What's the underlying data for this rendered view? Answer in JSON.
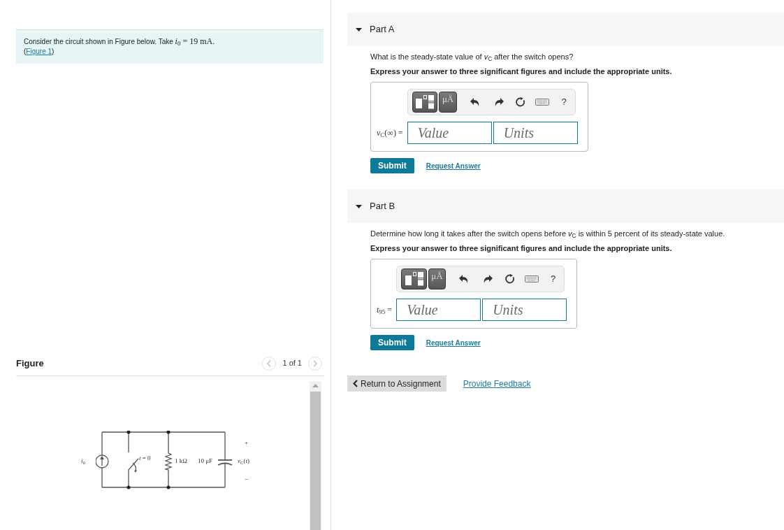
{
  "problem": {
    "text": "Consider the circuit shown in Figure below. Take ",
    "math": "*i*$_{0}$ = 19 mA.",
    "figure_link": {
      "open": "(",
      "label": "Figure 1",
      "close": ")"
    }
  },
  "figure": {
    "title": "Figure",
    "pager": {
      "prev": {
        "disabled": true
      },
      "position": "1 of 1",
      "next": {
        "disabled": true
      }
    },
    "diagram": {
      "source_label": "*i*$_{0}$",
      "switch_label": "*t* = 0",
      "resistor_label": "1 kΩ",
      "capacitor_label": "10 μF",
      "plus_sign": "+",
      "voltage_label": "*v*$_{C}$(*t*)",
      "minus_sign": "−"
    }
  },
  "parts": [
    {
      "title": "Part A",
      "expanded": true,
      "question": "What is the steady-state value of *v*$_{C}$ after the switch opens?",
      "instruction": "Express your answer to three significant figures and include the appropriate units.",
      "toolbar": {
        "units_button": "μÅ",
        "help_button": "?"
      },
      "answer_label": "*v*$_{C}$(∞) =",
      "value_placeholder": "Value",
      "units_placeholder": "Units",
      "submit": "Submit",
      "request_answer": "Request Answer"
    },
    {
      "title": "Part B",
      "expanded": true,
      "question": "Determine how long it takes after the switch opens before *v*$_{C}$ is within 5 percent of its steady-state value.",
      "instruction": "Express your answer to three significant figures and include the appropriate units.",
      "toolbar": {
        "units_button": "μÅ",
        "help_button": "?"
      },
      "answer_label": "*t*$_{95}$ =",
      "value_placeholder": "Value",
      "units_placeholder": "Units",
      "submit": "Submit",
      "request_answer": "Request Answer"
    }
  ],
  "footer": {
    "return_button": "Return to Assignment",
    "feedback_link": "Provide Feedback"
  }
}
